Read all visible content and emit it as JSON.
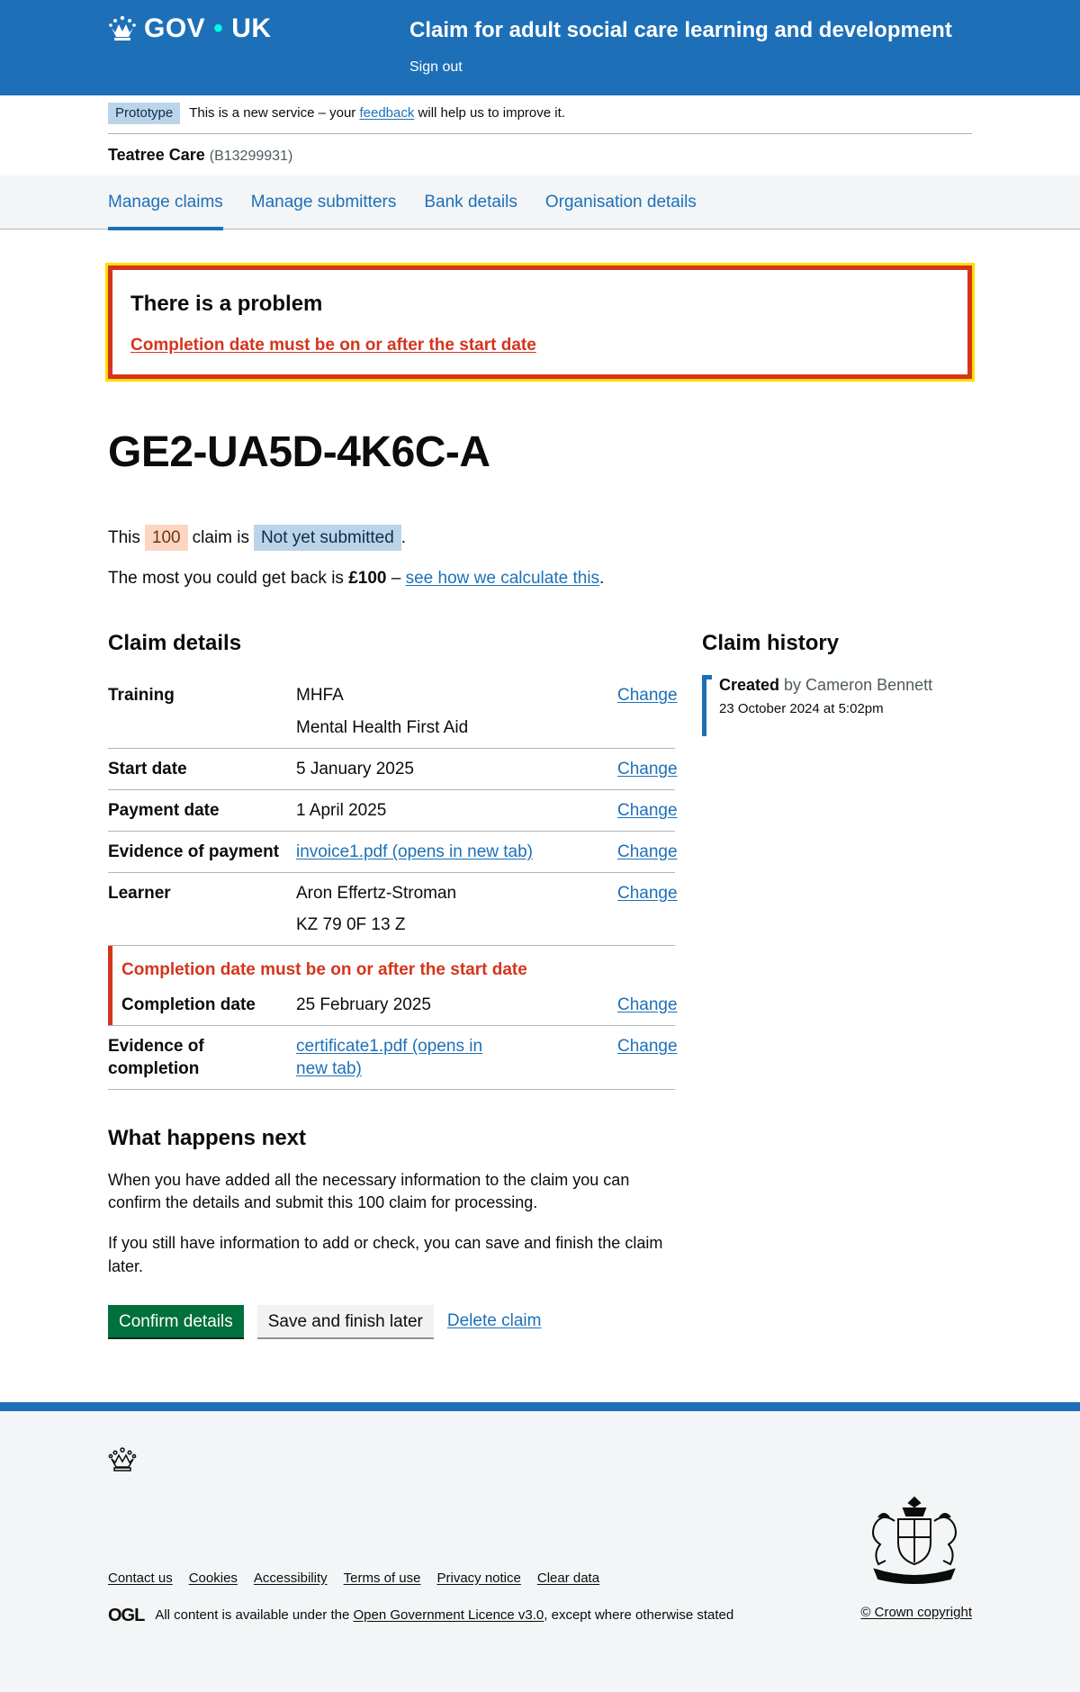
{
  "header": {
    "logo_text_1": "GOV",
    "logo_dot": "•",
    "logo_text_2": "UK",
    "service_name": "Claim for adult social care learning and development",
    "sign_out": "Sign out"
  },
  "phase_banner": {
    "tag": "Prototype",
    "text_before": "This is a new service – your ",
    "link": "feedback",
    "text_after": " will help us to improve it."
  },
  "organisation": {
    "name": "Teatree Care",
    "id": "(B13299931)"
  },
  "nav": {
    "items": [
      {
        "label": "Manage claims",
        "active": true
      },
      {
        "label": "Manage submitters",
        "active": false
      },
      {
        "label": "Bank details",
        "active": false
      },
      {
        "label": "Organisation details",
        "active": false
      }
    ]
  },
  "error_summary": {
    "title": "There is a problem",
    "error_link": "Completion date must be on or after the start date"
  },
  "claim": {
    "reference": "GE2-UA5D-4K6C-A",
    "status_prefix": "This",
    "claim_type": "100",
    "status_mid": "claim is",
    "status": "Not yet submitted",
    "status_suffix": ".",
    "max_prefix": "The most you could get back is ",
    "max_amount": "£100",
    "max_sep": " – ",
    "max_link": "see how we calculate this",
    "max_suffix": "."
  },
  "claim_details": {
    "title": "Claim details",
    "change_label": "Change",
    "rows": {
      "training": {
        "key": "Training",
        "value_1": "MHFA",
        "value_2": "Mental Health First Aid"
      },
      "start_date": {
        "key": "Start date",
        "value": "5 January 2025"
      },
      "payment_date": {
        "key": "Payment date",
        "value": "1 April 2025"
      },
      "evidence_payment": {
        "key": "Evidence of payment",
        "value": "invoice1.pdf (opens in new tab)"
      },
      "learner": {
        "key": "Learner",
        "value_1": "Aron Effertz-Stroman",
        "value_2": "KZ 79 0F 13 Z"
      },
      "completion_date": {
        "key": "Completion date",
        "value": "25 February 2025",
        "error": "Completion date must be on or after the start date"
      },
      "evidence_completion": {
        "key": "Evidence of completion",
        "value": "certificate1.pdf (opens in new tab)"
      }
    }
  },
  "claim_history": {
    "title": "Claim history",
    "event": "Created",
    "by": "by Cameron Bennett",
    "when": "23 October 2024 at 5:02pm"
  },
  "what_next": {
    "title": "What happens next",
    "para_1": "When you have added all the necessary information to the claim you can confirm the details and submit this 100 claim for processing.",
    "para_2": "If you still have information to add or check, you can save and finish the claim later.",
    "confirm_button": "Confirm details",
    "save_button": "Save and finish later",
    "delete_link": "Delete claim"
  },
  "footer": {
    "links": [
      "Contact us",
      "Cookies",
      "Accessibility",
      "Terms of use",
      "Privacy notice",
      "Clear data"
    ],
    "ogl": "OGL",
    "licence_prefix": "All content is available under the ",
    "licence_link": "Open Government Licence v3.0",
    "licence_suffix": ", except where otherwise stated",
    "copyright": "© Crown copyright"
  },
  "colors": {
    "brand_blue": "#1d70b8",
    "error_red": "#d4351c",
    "focus_yellow": "#ffdd00",
    "button_green": "#00703c"
  },
  "icons": {
    "header_crown": "crown-icon",
    "footer_crown": "crown-icon",
    "royal_arms": "royal-coat-of-arms-icon"
  }
}
